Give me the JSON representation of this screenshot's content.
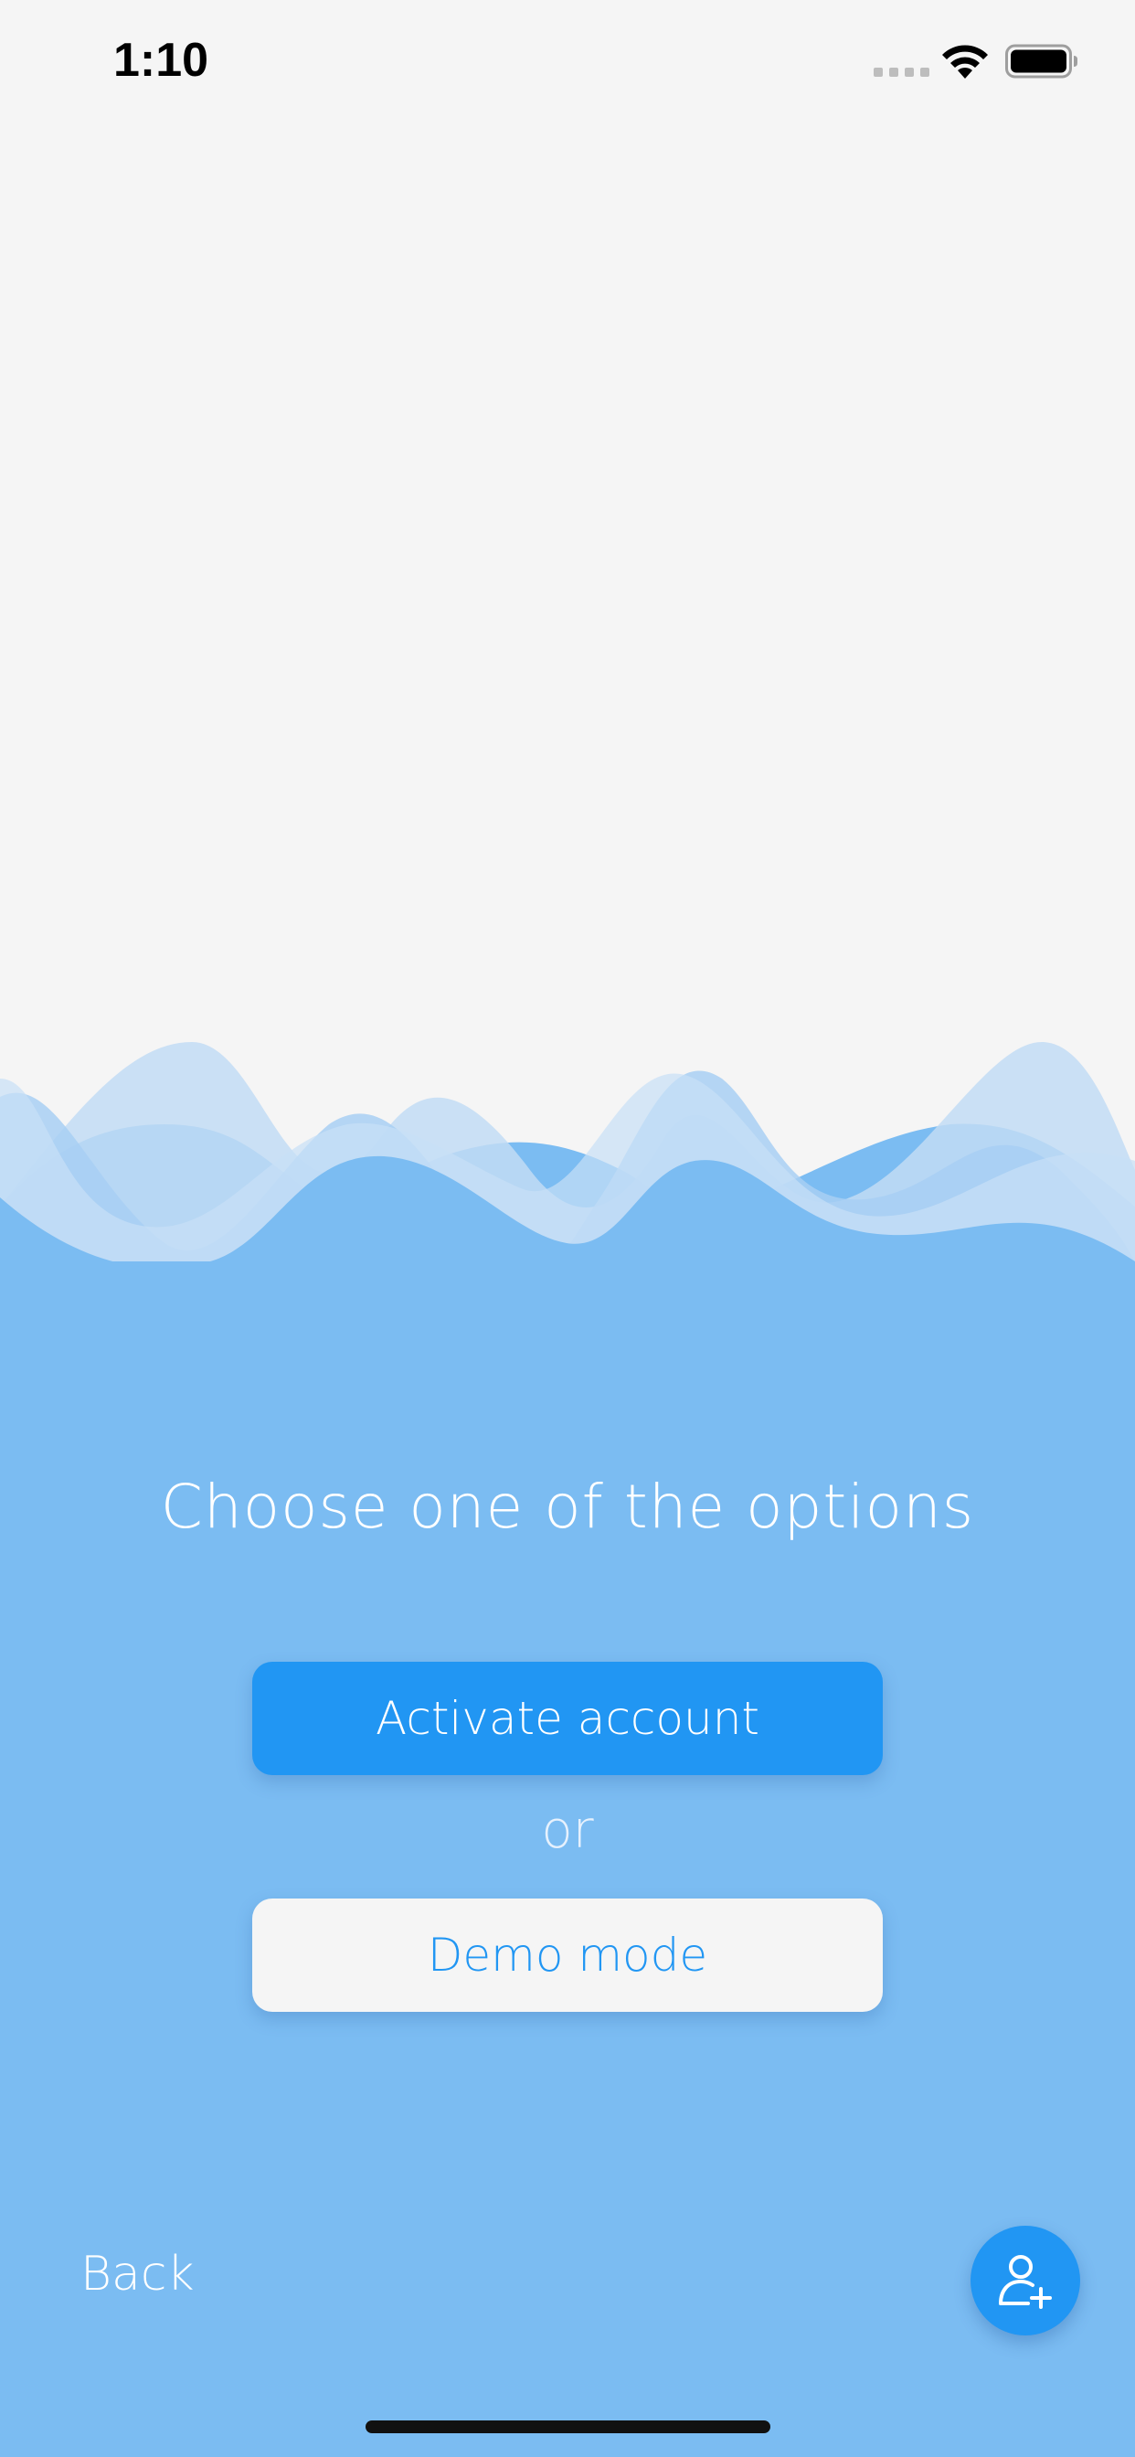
{
  "status_bar": {
    "time": "1:10"
  },
  "icons": {
    "wifi": "wifi-icon",
    "battery": "battery-icon",
    "signal": "cellular-signal-icon",
    "add_user": "add-user-icon"
  },
  "colors": {
    "background": "#f5f5f5",
    "wave_light": "#c2dcf4",
    "wave_mid": "#9dc9f2",
    "wave_base": "#7bbcf2",
    "accent": "#2196f3",
    "text_on_blue": "#ffffff"
  },
  "main": {
    "title": "Choose one of the options",
    "activate_label": "Activate account",
    "separator": "or",
    "demo_label": "Demo mode"
  },
  "footer": {
    "back_label": "Back"
  }
}
